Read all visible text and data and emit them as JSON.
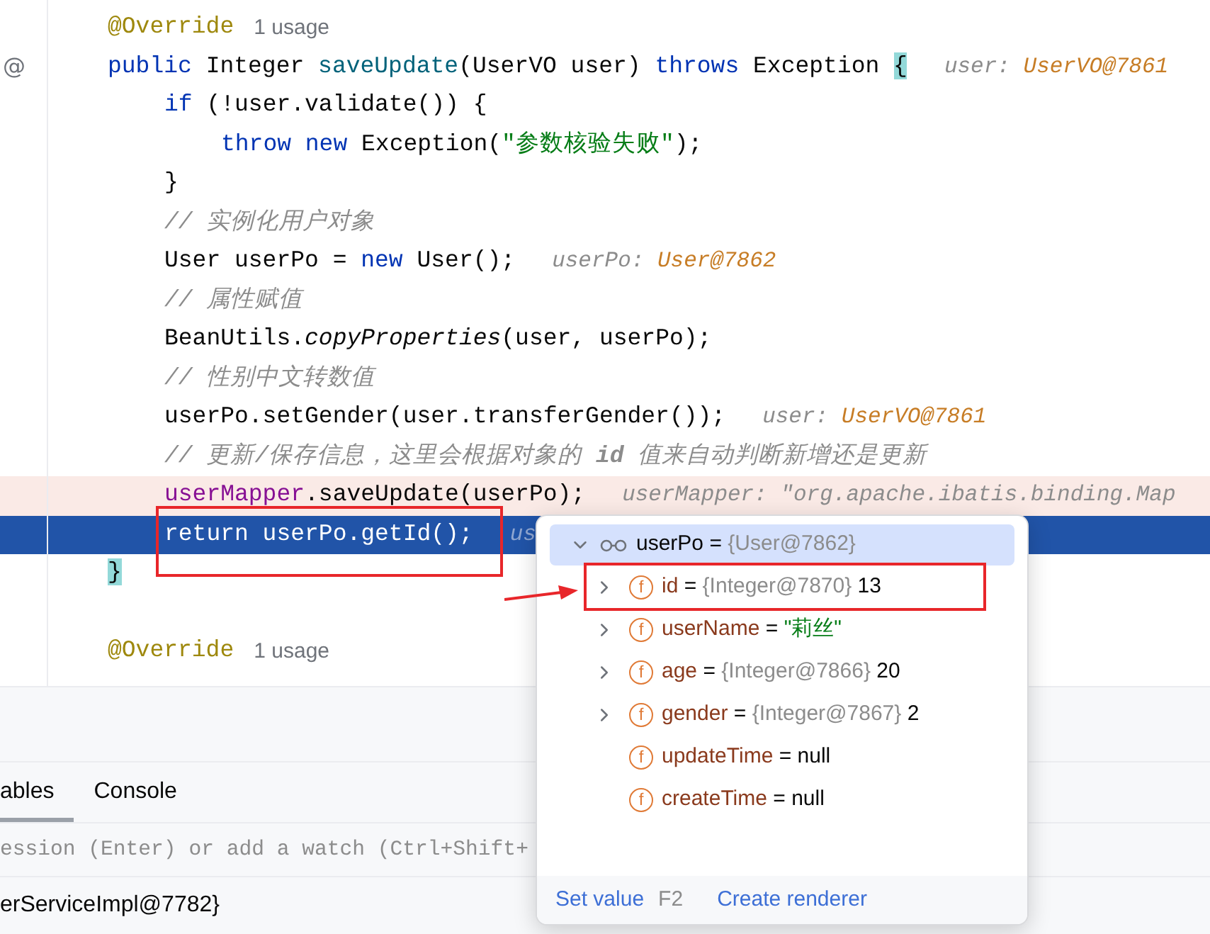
{
  "editor": {
    "lines": [
      {
        "kind": "code",
        "segments": [
          {
            "kind": "annotation",
            "text": "@Override"
          }
        ],
        "usage": "1 usage"
      },
      {
        "kind": "code",
        "gutter": "@",
        "segments": [
          {
            "kind": "keyword",
            "text": "public"
          },
          {
            "kind": "plain",
            "text": " Integer "
          },
          {
            "kind": "method",
            "text": "saveUpdate"
          },
          {
            "kind": "plain",
            "text": "(UserVO user) "
          },
          {
            "kind": "keyword",
            "text": "throws"
          },
          {
            "kind": "plain",
            "text": " Exception "
          },
          {
            "kind": "brace",
            "text": "{"
          }
        ],
        "hint": {
          "name": "user: ",
          "value": "UserVO@7861",
          "kind": "object"
        },
        "children": [
          {
            "kind": "code",
            "segments": [
              {
                "kind": "keyword",
                "text": "if"
              },
              {
                "kind": "plain",
                "text": " (!user.validate()) {"
              }
            ],
            "children": [
              {
                "kind": "code",
                "segments": [
                  {
                    "kind": "keyword",
                    "text": "throw new"
                  },
                  {
                    "kind": "plain",
                    "text": " Exception("
                  },
                  {
                    "kind": "string",
                    "text": "\"参数核验失败\""
                  },
                  {
                    "kind": "plain",
                    "text": ");"
                  }
                ]
              }
            ]
          },
          {
            "kind": "code",
            "segments": [
              {
                "kind": "plain",
                "text": "}"
              }
            ]
          },
          {
            "kind": "code",
            "segments": [
              {
                "kind": "comment",
                "text": "// 实例化用户对象"
              }
            ]
          },
          {
            "kind": "code",
            "segments": [
              {
                "kind": "plain",
                "text": "User userPo = "
              },
              {
                "kind": "keyword",
                "text": "new"
              },
              {
                "kind": "plain",
                "text": " User();"
              }
            ],
            "hint": {
              "name": "userPo: ",
              "value": "User@7862",
              "kind": "object"
            }
          },
          {
            "kind": "code",
            "segments": [
              {
                "kind": "comment",
                "text": "// 属性赋值"
              }
            ]
          },
          {
            "kind": "code",
            "segments": [
              {
                "kind": "plain",
                "text": "BeanUtils."
              },
              {
                "kind": "static_method",
                "text": "copyProperties"
              },
              {
                "kind": "plain",
                "text": "(user, userPo);"
              }
            ]
          },
          {
            "kind": "code",
            "segments": [
              {
                "kind": "comment",
                "text": "// 性别中文转数值"
              }
            ]
          },
          {
            "kind": "code",
            "segments": [
              {
                "kind": "plain",
                "text": "userPo.setGender(user.transferGender());"
              }
            ],
            "hint": {
              "name": "user: ",
              "value": "UserVO@7861",
              "kind": "object"
            }
          },
          {
            "kind": "code",
            "segments": [
              {
                "kind": "comment",
                "text": "// 更新/保存信息，这里会根据对象的 "
              },
              {
                "kind": "comment_bold",
                "text": "id"
              },
              {
                "kind": "comment",
                "text": " 值来自动判断新增还是更新"
              }
            ]
          },
          {
            "kind": "code",
            "breakpoint": true,
            "segments": [
              {
                "kind": "field",
                "text": "userMapper"
              },
              {
                "kind": "plain",
                "text": ".saveUpdate(userPo);"
              }
            ],
            "hint": {
              "name": "userMapper: ",
              "value": "\"org.apache.ibatis.binding.Map",
              "kind": "text"
            }
          },
          {
            "kind": "code",
            "execution_point": true,
            "segments": [
              {
                "kind": "plain",
                "text": "return userPo.getId();"
              }
            ],
            "hint": {
              "name": "us"
            }
          }
        ]
      },
      {
        "kind": "code",
        "segments": [
          {
            "kind": "brace",
            "text": "}"
          }
        ]
      },
      {
        "kind": "blank"
      },
      {
        "kind": "code",
        "segments": [
          {
            "kind": "annotation",
            "text": "@Override"
          }
        ],
        "usage": "1 usage"
      }
    ]
  },
  "debug_panel": {
    "tabs": [
      {
        "label": "ables",
        "selected": true
      },
      {
        "label": "Console",
        "selected": false
      }
    ],
    "evaluate_field": {
      "placeholder": "ession (Enter) or add a watch (Ctrl+Shift+"
    },
    "frame_row": "erServiceImpl@7782}"
  },
  "variables_popup": {
    "root": {
      "name": "userPo",
      "separator": "=",
      "type": "{User@7862}",
      "expanded": true,
      "selected": true,
      "children": [
        {
          "badge": "f",
          "name": "id",
          "separator": "=",
          "type": "{Integer@7870}",
          "value": "13",
          "kind": "number",
          "expandable": true,
          "selected": false
        },
        {
          "badge": "f",
          "name": "userName",
          "separator": "=",
          "value": "\"莉丝\"",
          "kind": "string",
          "expandable": true,
          "selected": false
        },
        {
          "badge": "f",
          "name": "age",
          "separator": "=",
          "type": "{Integer@7866}",
          "value": "20",
          "kind": "number",
          "expandable": true,
          "selected": false
        },
        {
          "badge": "f",
          "name": "gender",
          "separator": "=",
          "type": "{Integer@7867}",
          "value": "2",
          "kind": "number",
          "expandable": true,
          "selected": false
        },
        {
          "badge": "f",
          "name": "updateTime",
          "separator": "=",
          "value": "null",
          "kind": "null",
          "expandable": false,
          "selected": false
        },
        {
          "badge": "f",
          "name": "createTime",
          "separator": "=",
          "value": "null",
          "kind": "null",
          "expandable": false,
          "selected": false
        }
      ]
    },
    "actions": [
      {
        "label": "Set value",
        "shortcut": "F2"
      },
      {
        "label": "Create renderer"
      }
    ]
  },
  "annotations": [
    {
      "kind": "frame"
    },
    {
      "kind": "frame"
    },
    {
      "kind": "arrow"
    }
  ]
}
